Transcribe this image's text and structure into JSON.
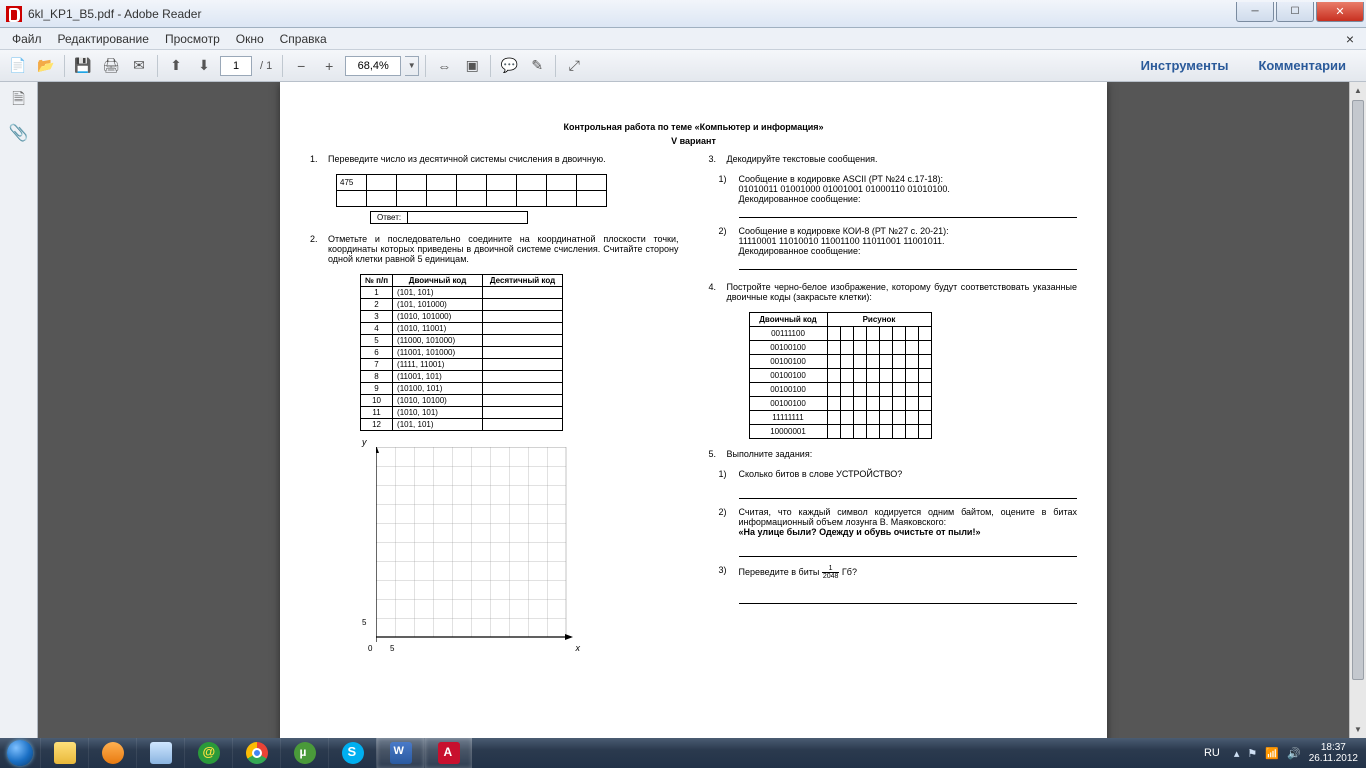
{
  "window": {
    "title": "6kl_KP1_B5.pdf - Adobe Reader"
  },
  "menu": {
    "file": "Файл",
    "edit": "Редактирование",
    "view": "Просмотр",
    "window": "Окно",
    "help": "Справка"
  },
  "toolbar": {
    "page_current": "1",
    "page_total": "/ 1",
    "zoom": "68,4%",
    "right_tools": "Инструменты",
    "right_comments": "Комментарии"
  },
  "doc": {
    "title": "Контрольная работа по теме «Компьютер и информация»",
    "variant": "V вариант",
    "t1": {
      "num": "1.",
      "text": "Переведите число из десятичной системы счисления в двоичную.",
      "value": "475",
      "answer_label": "Ответ:"
    },
    "t2": {
      "num": "2.",
      "text": "Отметьте и последовательно соедините на координатной плоскости точки, координаты которых приведены в двоичной системе счисления. Считайте сторону одной клетки равной 5 единицам.",
      "headers": {
        "n": "№ п/п",
        "bin": "Двоичный код",
        "dec": "Десятичный код"
      },
      "rows": [
        {
          "n": "1",
          "bin": "(101, 101)"
        },
        {
          "n": "2",
          "bin": "(101, 101000)"
        },
        {
          "n": "3",
          "bin": "(1010, 101000)"
        },
        {
          "n": "4",
          "bin": "(1010, 11001)"
        },
        {
          "n": "5",
          "bin": "(11000, 101000)"
        },
        {
          "n": "6",
          "bin": "(11001, 101000)"
        },
        {
          "n": "7",
          "bin": "(1111, 11001)"
        },
        {
          "n": "8",
          "bin": "(11001, 101)"
        },
        {
          "n": "9",
          "bin": "(10100, 101)"
        },
        {
          "n": "10",
          "bin": "(1010, 10100)"
        },
        {
          "n": "11",
          "bin": "(1010, 101)"
        },
        {
          "n": "12",
          "bin": "(101, 101)"
        }
      ],
      "axis": {
        "y": "y",
        "x": "x",
        "origin": "0",
        "tick5x": "5",
        "tick5y": "5"
      }
    },
    "t3": {
      "num": "3.",
      "text": "Декодируйте текстовые сообщения.",
      "s1": {
        "num": "1)",
        "line1": "Сообщение в кодировке ASCII (РТ №24 с.17-18):",
        "line2": "01010011 01001000 01001001 01000110 01010100.",
        "line3": "Декодированное сообщение:"
      },
      "s2": {
        "num": "2)",
        "line1": "Сообщение в кодировке КОИ-8 (РТ №27 с. 20-21):",
        "line2": "11110001 11010010 11001100 11011001 11001011.",
        "line3": "Декодированное сообщение:"
      }
    },
    "t4": {
      "num": "4.",
      "text": "Постройте черно-белое изображение, которому будут соответствовать указанные двоичные коды (закрасьте клетки):",
      "headers": {
        "code": "Двоичный код",
        "pic": "Рисунок"
      },
      "codes": [
        "00111100",
        "00100100",
        "00100100",
        "00100100",
        "00100100",
        "00100100",
        "11111111",
        "10000001"
      ]
    },
    "t5": {
      "num": "5.",
      "text": "Выполните задания:",
      "s1": {
        "num": "1)",
        "text": "Сколько битов в слове УСТРОЙСТВО?"
      },
      "s2": {
        "num": "2)",
        "text1": "Считая, что каждый символ кодируется одним байтом, оцените в битах информационный объем лозунга В. Маяковского:",
        "text2": "«На улице были? Одежду и обувь очистьте от пыли!»"
      },
      "s3": {
        "num": "3)",
        "text_pre": "Переведите в биты ",
        "frac_n": "1",
        "frac_d": "2048",
        "text_post": " Гб?"
      }
    }
  },
  "taskbar": {
    "lang": "RU",
    "time": "18:37",
    "date": "26.11.2012"
  }
}
